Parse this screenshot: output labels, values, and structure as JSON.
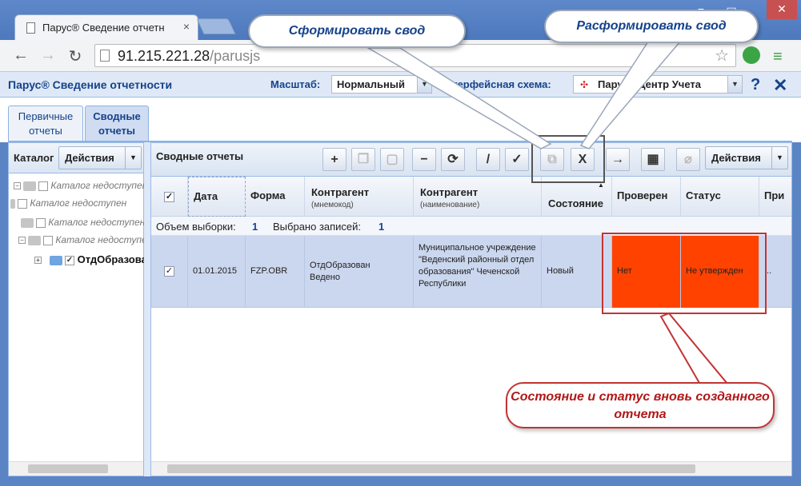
{
  "browser": {
    "tab_title": "Парус® Сведение отчетн",
    "tab_close": "×",
    "url_host": "91.215.221.28",
    "url_path": "/parusjs",
    "window_controls": [
      "−",
      "▭",
      "✕"
    ]
  },
  "app": {
    "title": "Парус® Сведение отчетности",
    "scale_label": "Масштаб:",
    "scale_value": "Нормальный",
    "scheme_label": "Интерфейсная схема:",
    "scheme_value": "Парус - Центр Учета",
    "help": "?",
    "close": "✕"
  },
  "tabs": [
    {
      "label": "Первичные отчеты",
      "active": false
    },
    {
      "label": "Сводные отчеты",
      "active": true
    }
  ],
  "left_panel": {
    "title": "Каталог",
    "actions_label": "Действия",
    "tree": [
      {
        "label": "Каталог недоступен",
        "expand": "−",
        "checked": false
      },
      {
        "label": "Каталог недоступен",
        "expand": "",
        "checked": false
      },
      {
        "label": "Каталог недоступен",
        "expand": "",
        "checked": false
      },
      {
        "label": "Каталог недоступен",
        "expand": "−",
        "checked": false
      },
      {
        "label": "ОтдОбразован",
        "expand": "+",
        "checked": true
      }
    ]
  },
  "right_panel": {
    "title": "Сводные отчеты",
    "actions_label": "Действия",
    "toolbar": [
      "+",
      "❐",
      "▢",
      "−",
      "⟳",
      "/",
      "✓",
      "⧉",
      "X",
      "→",
      "▦",
      "⌀"
    ],
    "columns": [
      {
        "title": "Дата",
        "sub": ""
      },
      {
        "title": "Форма",
        "sub": ""
      },
      {
        "title": "Контрагент",
        "sub": "(мнемокод)"
      },
      {
        "title": "Контрагент",
        "sub": "(наименование)"
      },
      {
        "title": "Состояние",
        "sub": ""
      },
      {
        "title": "Проверен",
        "sub": ""
      },
      {
        "title": "Статус",
        "sub": ""
      },
      {
        "title": "При",
        "sub": ""
      }
    ],
    "summary": {
      "volume_label": "Объем выборки:",
      "volume_value": "1",
      "selected_label": "Выбрано записей:",
      "selected_value": "1"
    },
    "rows": [
      {
        "date": "01.01.2015",
        "form": "FZP.OBR",
        "mnemo": "ОтдОбразован Ведено",
        "name": "Муниципальное учреждение \"Веденский районный отдел образования\" Чеченской Республики",
        "state": "Новый",
        "checked": "Нет",
        "status": "Не утвержден",
        "extra": "..."
      }
    ]
  },
  "callouts": {
    "form_summary": "Сформировать свод",
    "unform_summary": "Расформировать свод",
    "state_status": "Состояние и статус вновь созданного отчета"
  },
  "colors": {
    "accent": "#15428b",
    "highlight": "#ff4200",
    "callout_red": "#c23434"
  }
}
